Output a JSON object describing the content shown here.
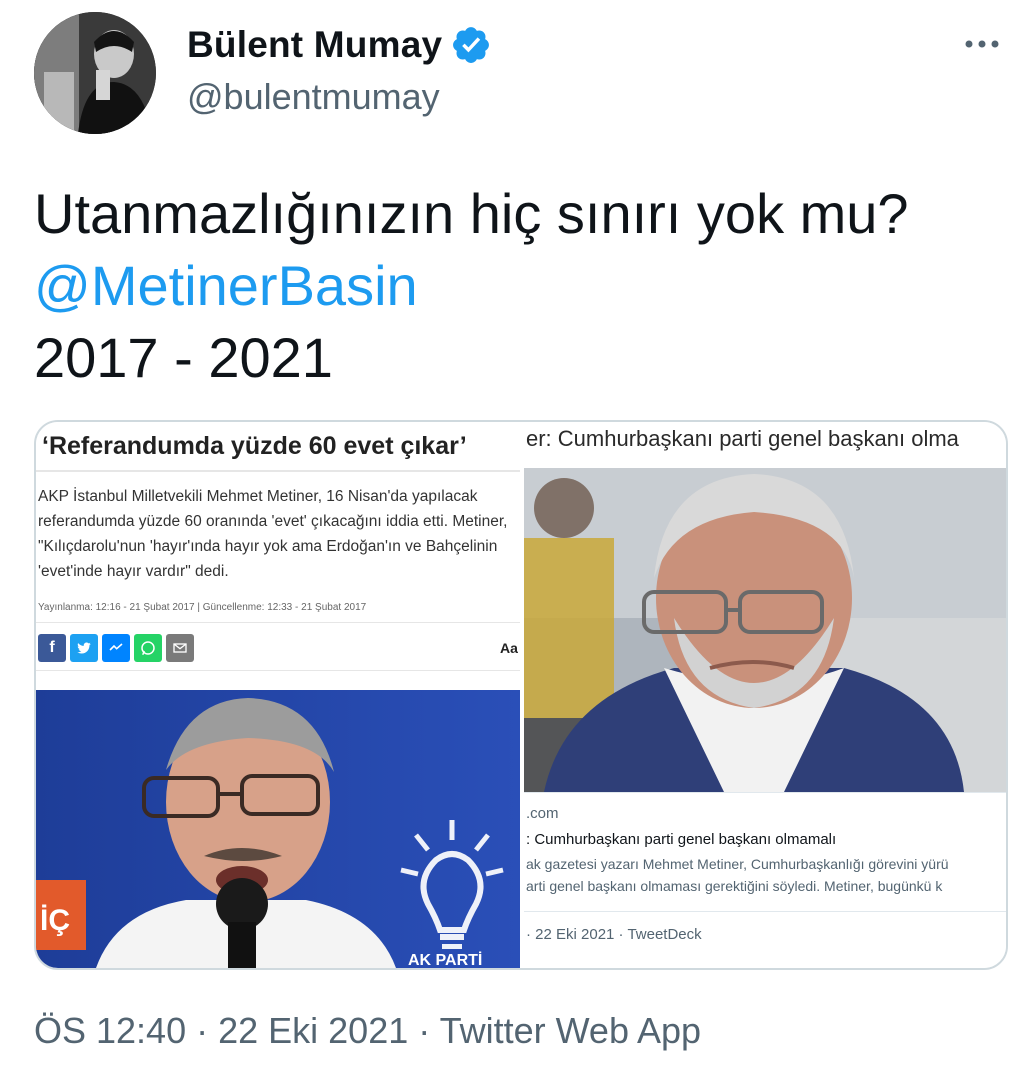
{
  "author": {
    "display_name": "Bülent Mumay",
    "handle": "@bulentmumay",
    "verified": true,
    "avatar_icon": "profile-photo"
  },
  "tweet": {
    "line1": "Utanmazlığınızın hiç sınırı yok mu?",
    "mention": "@MetinerBasin",
    "line3": "2017 - 2021"
  },
  "media": {
    "left": {
      "headline": "‘Referandumda yüzde 60 evet çıkar’",
      "body": "AKP İstanbul Milletvekili Mehmet Metiner, 16 Nisan'da yapılacak referandumda yüzde 60 oranında 'evet' çıkacağını iddia etti. Metiner, \"Kılıçdarolu'nun 'hayır'ında hayır yok ama Erdoğan'ın ve Bahçelinin 'evet'inde hayır vardır\" dedi.",
      "dates": "Yayınlanma: 12:16 - 21 Şubat 2017  |  Güncellenme: 12:33 - 21 Şubat 2017",
      "share_icons": [
        "facebook-icon",
        "twitter-icon",
        "messenger-icon",
        "whatsapp-icon",
        "email-icon"
      ],
      "font_size_label": "Aa",
      "photo_sign_text": "AK PARTİ",
      "photo_side_text": "İÇ"
    },
    "right": {
      "headline": "er: Cumhurbaşkanı parti genel başkanı olma",
      "card_domain": ".com",
      "card_title": ": Cumhurbaşkanı parti genel başkanı olmamalı",
      "card_desc_line1": "ak gazetesi yazarı Mehmet Metiner, Cumhurbaşkanlığı görevini yürü",
      "card_desc_line2": "arti genel başkanı olmaması gerektiğini söyledi. Metiner, bugünkü k",
      "footer": "· 22 Eki 2021 · TweetDeck"
    }
  },
  "timestamp": "ÖS 12:40 · 22 Eki 2021 · Twitter Web App",
  "colors": {
    "accent": "#1d9bf0",
    "text": "#0f1419",
    "secondary": "#536471",
    "facebook": "#3b5998",
    "twitter": "#1da1f2",
    "messenger": "#0084ff",
    "whatsapp": "#25d366",
    "email": "#7a7a7a"
  }
}
